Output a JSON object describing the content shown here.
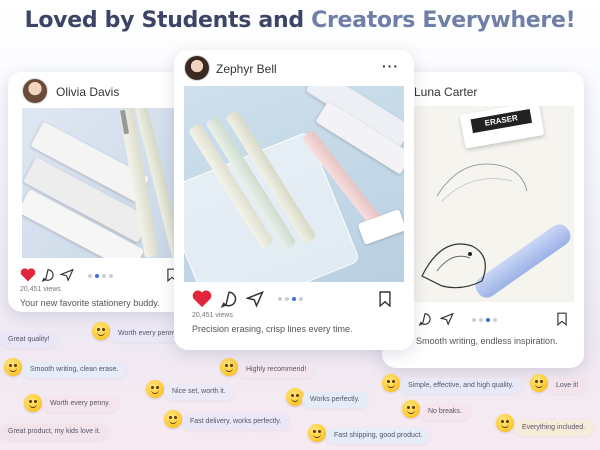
{
  "headline": {
    "part1": "Loved by Students and ",
    "part2": "Creators Everywhere!"
  },
  "posts": [
    {
      "user": "Olivia Davis",
      "views": "20,451 views",
      "caption": "Your new favorite stationery buddy."
    },
    {
      "user": "Zephyr Bell",
      "views": "20,451 views",
      "caption": "Precision erasing, crisp lines every time."
    },
    {
      "user": "Luna Carter",
      "caption": "Smooth writing, endless inspiration."
    }
  ],
  "photo_labels": {
    "eraser": "ERASER"
  },
  "reviews": [
    "Great quality!",
    "Worth every penny.",
    "Smooth writing, clean erase.",
    "Highly recommend!",
    "Nice set, worth it.",
    "Worth every penny.",
    "Works perfectly.",
    "Great product, my kids love it.",
    "Fast delivery, works perfectly.",
    "Fast shipping, good product.",
    "Simple, effective, and high quality.",
    "Love it!",
    "No breaks.",
    "Everything included."
  ],
  "colors": {
    "headline": "#3d4466",
    "accent": "#6f7fa8",
    "heart": "#e0263a",
    "pager_active": "#3b6fd8"
  },
  "icons": [
    "heart-icon",
    "comment-icon",
    "share-icon",
    "bookmark-icon",
    "more-icon"
  ]
}
